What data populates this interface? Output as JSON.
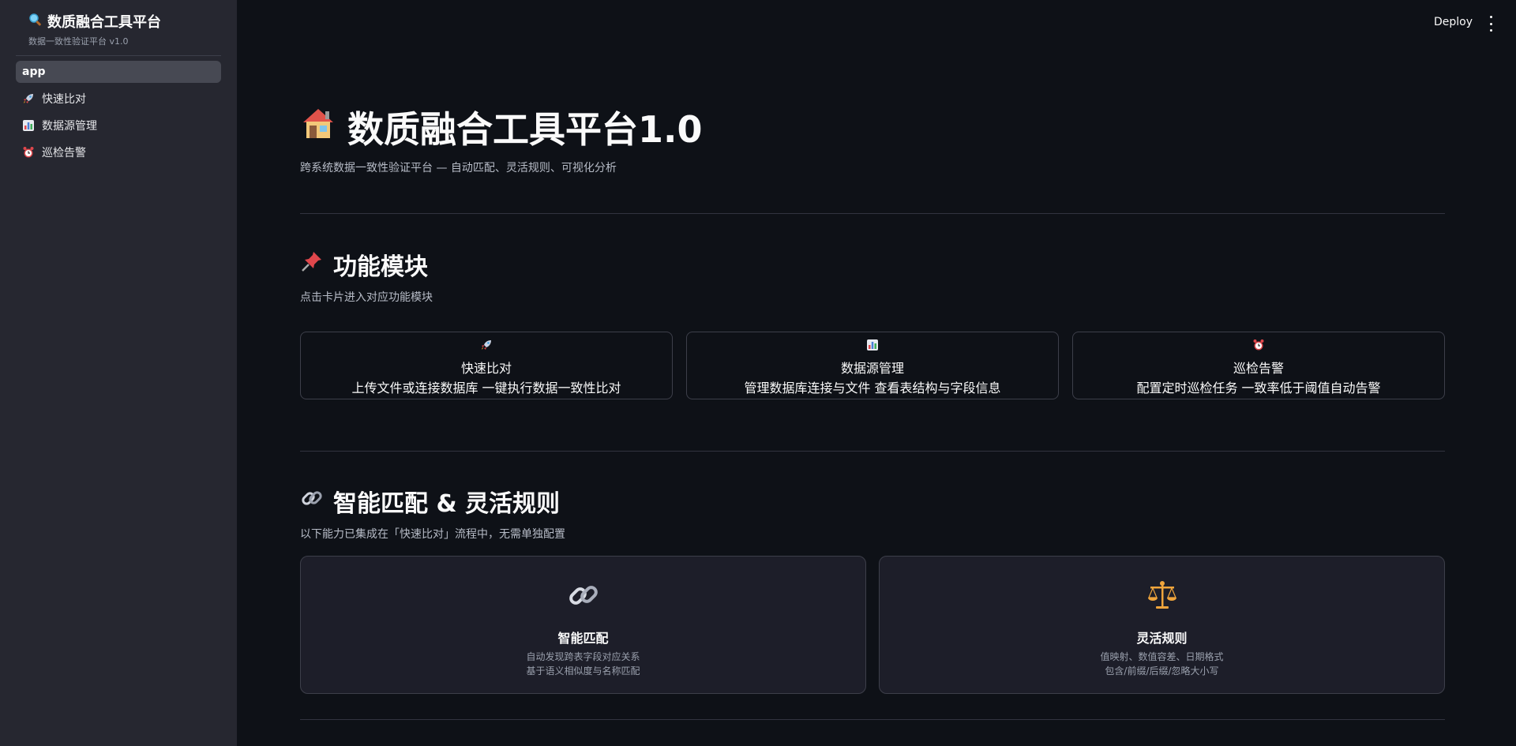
{
  "sidebar": {
    "brand_title": "数质融合工具平台",
    "brand_subtitle": "数据一致性验证平台 v1.0",
    "brand_icon": "magnifier-icon",
    "items": [
      {
        "label": "app",
        "icon": "",
        "active": true
      },
      {
        "label": "快速比对",
        "icon": "rocket-icon"
      },
      {
        "label": "数据源管理",
        "icon": "bar-chart-icon"
      },
      {
        "label": "巡检告警",
        "icon": "alarm-clock-icon"
      }
    ]
  },
  "topbar": {
    "deploy_label": "Deploy",
    "menu_icon": "kebab-menu-icon"
  },
  "main": {
    "title": "数质融合工具平台1.0",
    "title_icon": "house-icon",
    "subtitle": "跨系统数据一致性验证平台 — 自动匹配、灵活规则、可视化分析",
    "section_modules": {
      "title": "功能模块",
      "icon": "pushpin-icon",
      "subtitle": "点击卡片进入对应功能模块",
      "cards": [
        {
          "icon": "rocket-icon",
          "title": "快速比对",
          "desc": "上传文件或连接数据库 一键执行数据一致性比对"
        },
        {
          "icon": "bar-chart-icon",
          "title": "数据源管理",
          "desc": "管理数据库连接与文件 查看表结构与字段信息"
        },
        {
          "icon": "alarm-clock-icon",
          "title": "巡检告警",
          "desc": "配置定时巡检任务 一致率低于阈值自动告警"
        }
      ]
    },
    "section_features": {
      "title": "智能匹配 & 灵活规则",
      "icon": "link-icon",
      "subtitle": "以下能力已集成在「快速比对」流程中，无需单独配置",
      "cards": [
        {
          "icon": "link-icon",
          "title": "智能匹配",
          "line1": "自动发现跨表字段对应关系",
          "line2": "基于语义相似度与名称匹配"
        },
        {
          "icon": "balance-scale-icon",
          "title": "灵活规则",
          "line1": "值映射、数值容差、日期格式",
          "line2": "包含/前缀/后缀/忽略大小写"
        }
      ]
    }
  },
  "colors": {
    "background": "#0e1117",
    "sidebar": "#262730",
    "active_item": "#474953",
    "card_border": "#3d3f4a",
    "feature_card_bg": "#1d1e29"
  }
}
